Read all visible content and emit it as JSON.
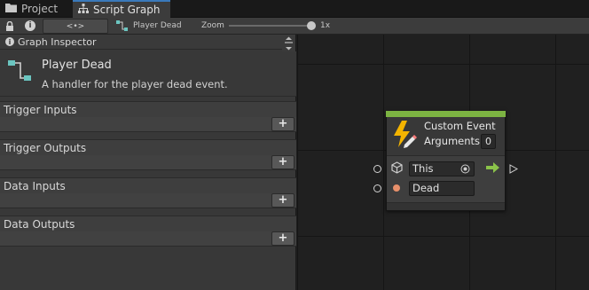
{
  "tabs": [
    {
      "label": "Project",
      "icon": "folder-icon"
    },
    {
      "label": "Script Graph",
      "icon": "hierarchy-icon"
    }
  ],
  "toolbar": {
    "graph_name": "Player Dead",
    "code_button": "<•>",
    "zoom_label": "Zoom",
    "zoom_value": "1x",
    "zoom_level": 1.0
  },
  "inspector": {
    "header": "Graph Inspector",
    "title": "Player Dead",
    "description": "A handler for the player dead event."
  },
  "sections": [
    {
      "label": "Trigger Inputs",
      "add": "+"
    },
    {
      "label": "Trigger Outputs",
      "add": "+"
    },
    {
      "label": "Data Inputs",
      "add": "+"
    },
    {
      "label": "Data Outputs",
      "add": "+"
    }
  ],
  "node": {
    "title": "Custom Event",
    "arguments_label": "Arguments",
    "arguments_value": "0",
    "target_value": "This",
    "event_name": "Dead",
    "accent_color": "#7cb342",
    "icon": "lightning-pencil-icon"
  },
  "colors": {
    "tab_accent": "#3a79bb",
    "node_header": "#7cb342",
    "flow_arrow": "#8bc34a",
    "string_port": "#e8906b",
    "icon_teal": "#6bc5c0"
  }
}
